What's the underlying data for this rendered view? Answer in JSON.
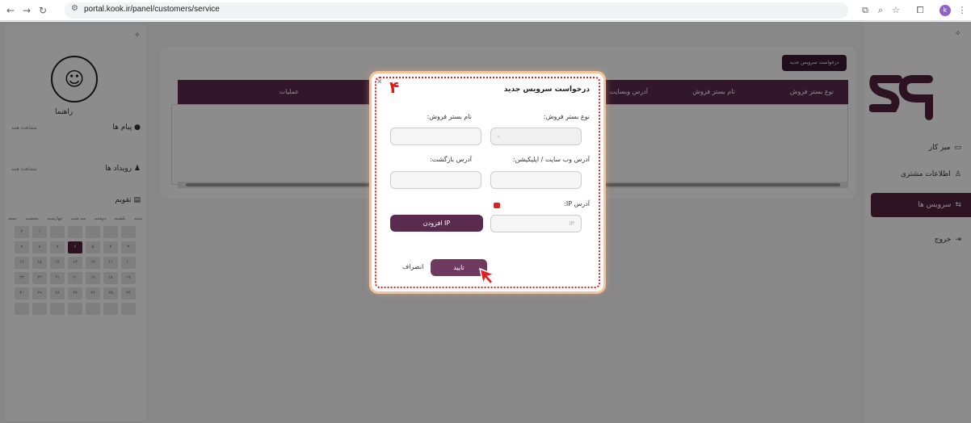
{
  "browser": {
    "url": "portal.kook.ir/panel/customers/service",
    "profile_initial": "k"
  },
  "sidebar": {
    "items": [
      {
        "label": "میز کار"
      },
      {
        "label": "اطلاعات مشتری"
      },
      {
        "label": "سرویس ها"
      },
      {
        "label": "خروج"
      }
    ]
  },
  "left_panel": {
    "guide_label": "راهنما",
    "messages_title": "پیام ها",
    "messages_see_all": "مشاهده همه",
    "events_title": "رویداد ها",
    "events_see_all": "مشاهده همه",
    "calendar_title": "تقویم",
    "weekdays": [
      "شنبه",
      "یکشنبه",
      "دوشنبه",
      "سه شنبه",
      "چهارشنبه",
      "پنجشنبه",
      "جمعه"
    ],
    "dates": [
      "",
      "",
      "",
      "",
      "",
      "۱",
      "۲",
      "۳",
      "۴",
      "۵",
      "۶",
      "۷",
      "۸",
      "۹",
      "۱۰",
      "۱۱",
      "۱۲",
      "۱۳",
      "۱۴",
      "۱۵",
      "۱۶",
      "۱۷",
      "۱۸",
      "۱۹",
      "۲۰",
      "۲۱",
      "۲۲",
      "۲۳",
      "۲۴",
      "۲۵",
      "۲۶",
      "۲۷",
      "۲۸",
      "۲۹",
      "۳۰",
      "",
      "",
      "",
      "",
      "",
      "",
      ""
    ]
  },
  "main": {
    "new_service_button": "درخواست سرویس جدید",
    "columns": [
      "نوع بستر فروش",
      "نام بستر فروش",
      "آدرس وبسایت",
      "عملیات"
    ]
  },
  "modal": {
    "title": "درخواست سرویس جدید",
    "step_number": "۴",
    "platform_type_label": "نوع بستر فروش:",
    "platform_name_label": "نام بستر فروش:",
    "website_label": "آدرس وب سایت / اپلیکیشن:",
    "return_address_label": "آدرس بازگشت:",
    "ip_label": "آدرس IP:",
    "ip_placeholder": "IP",
    "add_ip_button": "افزودن IP",
    "confirm_button": "تایید",
    "cancel_button": "انصراف"
  },
  "colors": {
    "brand": "#5b2a4f",
    "brand_dark": "#3b1a33",
    "annotation_red": "#e02020",
    "highlight_glow": "#f6c49a"
  }
}
